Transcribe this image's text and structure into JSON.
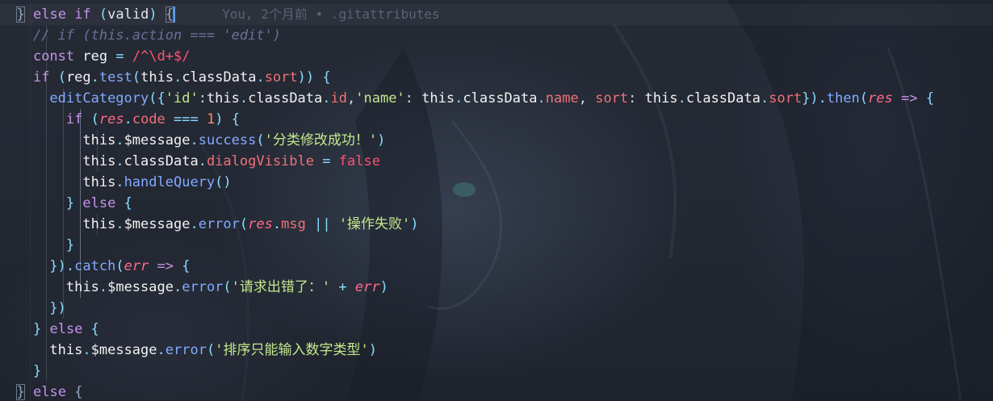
{
  "editor": {
    "blame": "You, 2个月前 • .gitattributes",
    "tokens": {
      "else": "else",
      "if": "if",
      "valid": "valid",
      "comment_edit": "// if (this.action === 'edit')",
      "const": "const",
      "reg": "reg",
      "regex": "/^\\d+$/",
      "test": "test",
      "this": "this",
      "classData": "classData",
      "sort": "sort",
      "editCategory": "editCategory",
      "str_id": "'id'",
      "id": "id",
      "str_name": "'name'",
      "name": "name",
      "sort_key": "sort",
      "then": "then",
      "res": "res",
      "code": "code",
      "one": "1",
      "message": "$message",
      "success": "success",
      "str_success": "'分类修改成功！'",
      "dialogVisible": "dialogVisible",
      "false": "false",
      "handleQuery": "handleQuery",
      "error": "error",
      "msg": "msg",
      "str_failed": "'操作失败'",
      "catch": "catch",
      "err": "err",
      "str_request_error": "'请求出错了：'",
      "str_sort_number": "'排序只能输入数字类型'"
    }
  }
}
